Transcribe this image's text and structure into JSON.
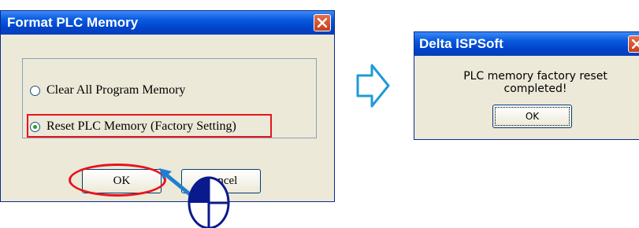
{
  "dialog_format": {
    "title": "Format PLC Memory",
    "options": [
      {
        "label": "Clear All Program Memory",
        "selected": false
      },
      {
        "label": "Reset PLC Memory (Factory Setting)",
        "selected": true
      }
    ],
    "ok_label": "OK",
    "cancel_label": "Cancel"
  },
  "dialog_result": {
    "title": "Delta ISPSoft",
    "message": "PLC memory factory reset completed!",
    "ok_label": "OK"
  },
  "icons": {
    "close": "close-x-icon",
    "arrow": "right-arrow-icon",
    "mouse": "mouse-icon",
    "pointer": "pointer-arrow-icon"
  },
  "colors": {
    "titlebar": "#0a5ce0",
    "highlight": "#e8141c",
    "arrow": "#1e9bd7",
    "dialog_bg": "#ece9d8"
  }
}
